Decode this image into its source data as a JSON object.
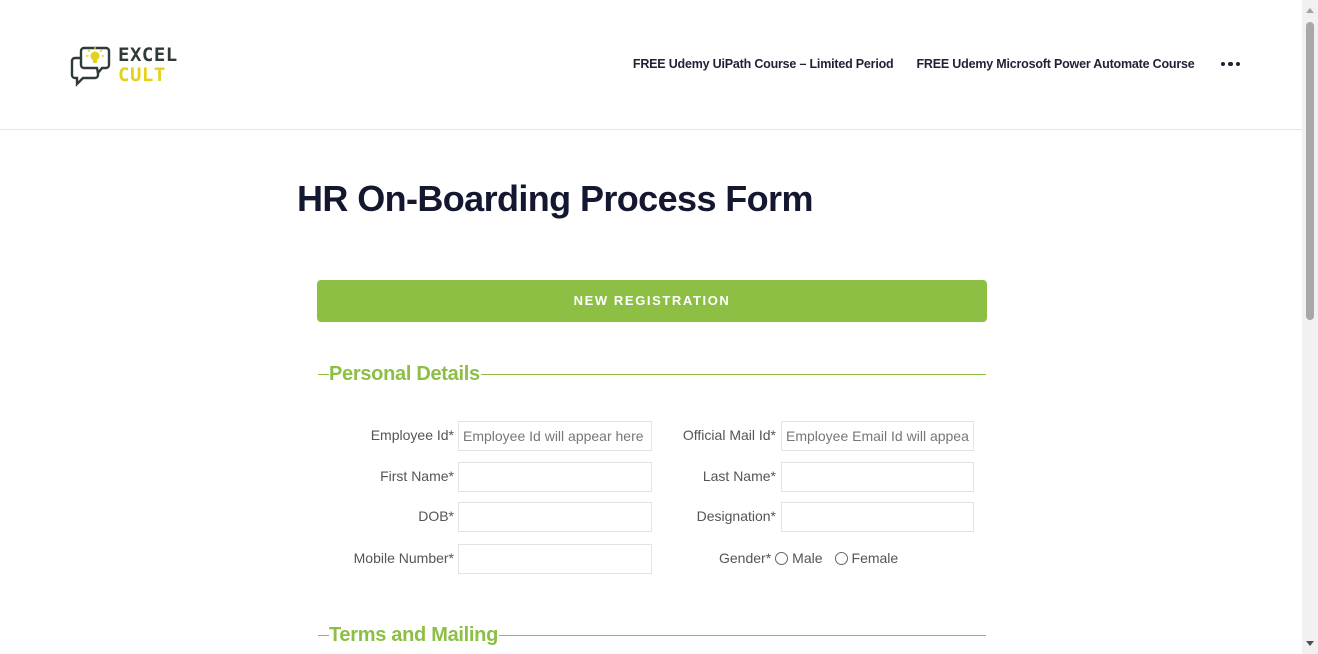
{
  "header": {
    "logo": {
      "line1": "EXCEL",
      "line2": "CULT"
    },
    "nav": [
      {
        "label": "FREE Udemy UiPath Course – Limited Period"
      },
      {
        "label": "FREE Udemy Microsoft Power Automate Course"
      }
    ],
    "more_icon": "more-horizontal-icon"
  },
  "page": {
    "title": "HR On-Boarding Process Form",
    "registration_button": "NEW REGISTRATION"
  },
  "sections": {
    "personal": "Personal Details",
    "terms": "Terms and Mailing"
  },
  "form": {
    "employee_id": {
      "label": "Employee Id*",
      "placeholder": "Employee Id will appear here",
      "value": ""
    },
    "official_mail": {
      "label": "Official Mail Id*",
      "placeholder": "Employee Email Id will appear",
      "value": ""
    },
    "first_name": {
      "label": "First Name*",
      "placeholder": "",
      "value": ""
    },
    "last_name": {
      "label": "Last Name*",
      "placeholder": "",
      "value": ""
    },
    "dob": {
      "label": "DOB*",
      "placeholder": "",
      "value": ""
    },
    "designation": {
      "label": "Designation*",
      "placeholder": "",
      "value": ""
    },
    "mobile": {
      "label": "Mobile Number*",
      "placeholder": "",
      "value": ""
    },
    "gender": {
      "label": "Gender*",
      "options": [
        "Male",
        "Female"
      ],
      "selected": null
    }
  },
  "colors": {
    "accent": "#8cbf43",
    "title": "#13172f",
    "nav_text": "#1f2235",
    "logo_dark": "#2f3b3a",
    "logo_yellow": "#e3d21b"
  }
}
